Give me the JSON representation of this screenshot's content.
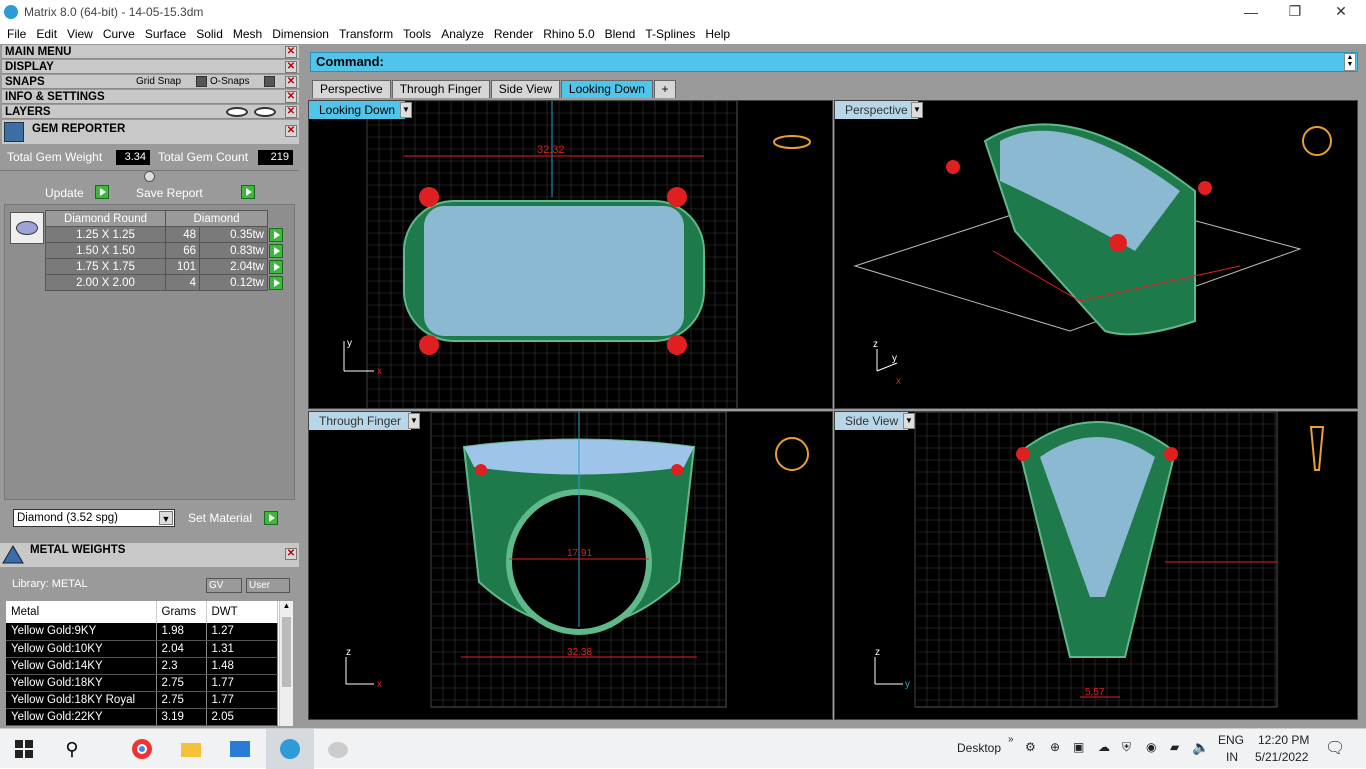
{
  "window": {
    "title": "Matrix 8.0 (64-bit) - 14-05-15.3dm",
    "minimize": "—",
    "restore": "❐",
    "close": "✕"
  },
  "menu": [
    "File",
    "Edit",
    "View",
    "Curve",
    "Surface",
    "Solid",
    "Mesh",
    "Dimension",
    "Transform",
    "Tools",
    "Analyze",
    "Render",
    "Rhino 5.0",
    "Blend",
    "T-Splines",
    "Help"
  ],
  "left": {
    "main_menu": "MAIN MENU",
    "display": "DISPLAY",
    "snaps": "SNAPS",
    "grid_snap": "Grid Snap",
    "o_snaps": "O-Snaps",
    "info_settings": "INFO & SETTINGS",
    "layers": "LAYERS",
    "gem_reporter": "GEM REPORTER",
    "total_gem_weight_label": "Total Gem Weight",
    "total_gem_weight": "3.34",
    "total_gem_count_label": "Total Gem Count",
    "total_gem_count": "219",
    "update": "Update",
    "save_report": "Save Report",
    "gem_headers": [
      "Diamond Round",
      "Diamond"
    ],
    "gems": [
      {
        "size": "1.25 X 1.25",
        "count": "48",
        "tw": "0.35tw"
      },
      {
        "size": "1.50 X 1.50",
        "count": "66",
        "tw": "0.83tw"
      },
      {
        "size": "1.75 X 1.75",
        "count": "101",
        "tw": "2.04tw"
      },
      {
        "size": "2.00 X 2.00",
        "count": "4",
        "tw": "0.12tw"
      }
    ],
    "material": "Diamond    (3.52 spg)",
    "set_material": "Set Material",
    "metal_weights": "METAL WEIGHTS",
    "library": "Library: METAL",
    "gv": "GV",
    "user": "User",
    "metal_headers": [
      "Metal",
      "Grams",
      "DWT"
    ],
    "metals": [
      {
        "name": "Yellow Gold:9KY",
        "grams": "1.98",
        "dwt": "1.27"
      },
      {
        "name": "Yellow Gold:10KY",
        "grams": "2.04",
        "dwt": "1.31"
      },
      {
        "name": "Yellow Gold:14KY",
        "grams": "2.3",
        "dwt": "1.48"
      },
      {
        "name": "Yellow Gold:18KY",
        "grams": "2.75",
        "dwt": "1.77"
      },
      {
        "name": "Yellow Gold:18KY Royal",
        "grams": "2.75",
        "dwt": "1.77"
      },
      {
        "name": "Yellow Gold:22KY",
        "grams": "3.19",
        "dwt": "2.05"
      }
    ]
  },
  "command": {
    "label": "Command:"
  },
  "tabs": [
    "Perspective",
    "Through Finger",
    "Side View",
    "Looking Down"
  ],
  "viewports": {
    "top_left": {
      "label": "Looking Down",
      "dim": "32.32",
      "axis_v": "y",
      "axis_h": "x"
    },
    "top_right": {
      "label": "Perspective",
      "axis_z": "z",
      "axis_y": "y",
      "axis_x": "x"
    },
    "bottom_left": {
      "label": "Through Finger",
      "dim_inner": "17.91",
      "dim_outer": "32.38",
      "axis_v": "z",
      "axis_h": "x"
    },
    "bottom_right": {
      "label": "Side View",
      "dim": "5.57",
      "axis_v": "z",
      "axis_h": "y"
    }
  },
  "taskbar": {
    "desktop": "Desktop",
    "lang1": "ENG",
    "lang2": "IN",
    "time": "12:20 PM",
    "date": "5/21/2022"
  },
  "colors": {
    "accent": "#51c4ea",
    "metal": "#1e7a4a",
    "gem": "#9fc4ea",
    "dimension": "#e02020"
  }
}
